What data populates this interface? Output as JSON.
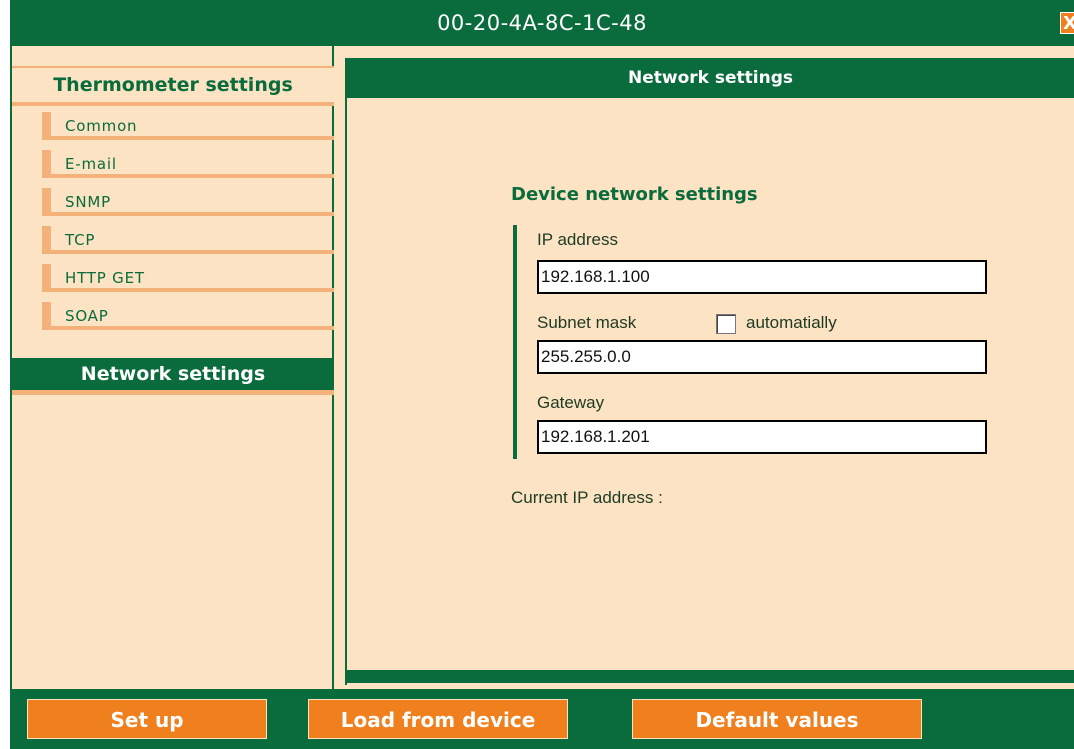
{
  "window": {
    "title": "00-20-4A-8C-1C-48",
    "close_label": "X"
  },
  "sidebar": {
    "header": "Thermometer settings",
    "items": [
      {
        "label": "Common"
      },
      {
        "label": "E-mail"
      },
      {
        "label": "SNMP"
      },
      {
        "label": "TCP"
      },
      {
        "label": "HTTP GET"
      },
      {
        "label": "SOAP"
      }
    ],
    "active_section": "Network settings"
  },
  "main": {
    "header": "Network settings",
    "section_title": "Device network settings",
    "ip_label": "IP address",
    "ip_value": "192.168.1.100",
    "subnet_label": "Subnet mask",
    "subnet_auto_label": "automatially",
    "subnet_auto_checked": false,
    "subnet_value": "255.255.0.0",
    "gateway_label": "Gateway",
    "gateway_value": "192.168.1.201",
    "current_ip_label": "Current IP address :"
  },
  "buttons": {
    "setup": "Set up",
    "load": "Load from device",
    "defaults": "Default values"
  },
  "colors": {
    "accent_green": "#0a6b3c",
    "background_peach": "#fbe3c3",
    "button_orange": "#f07f1e"
  }
}
